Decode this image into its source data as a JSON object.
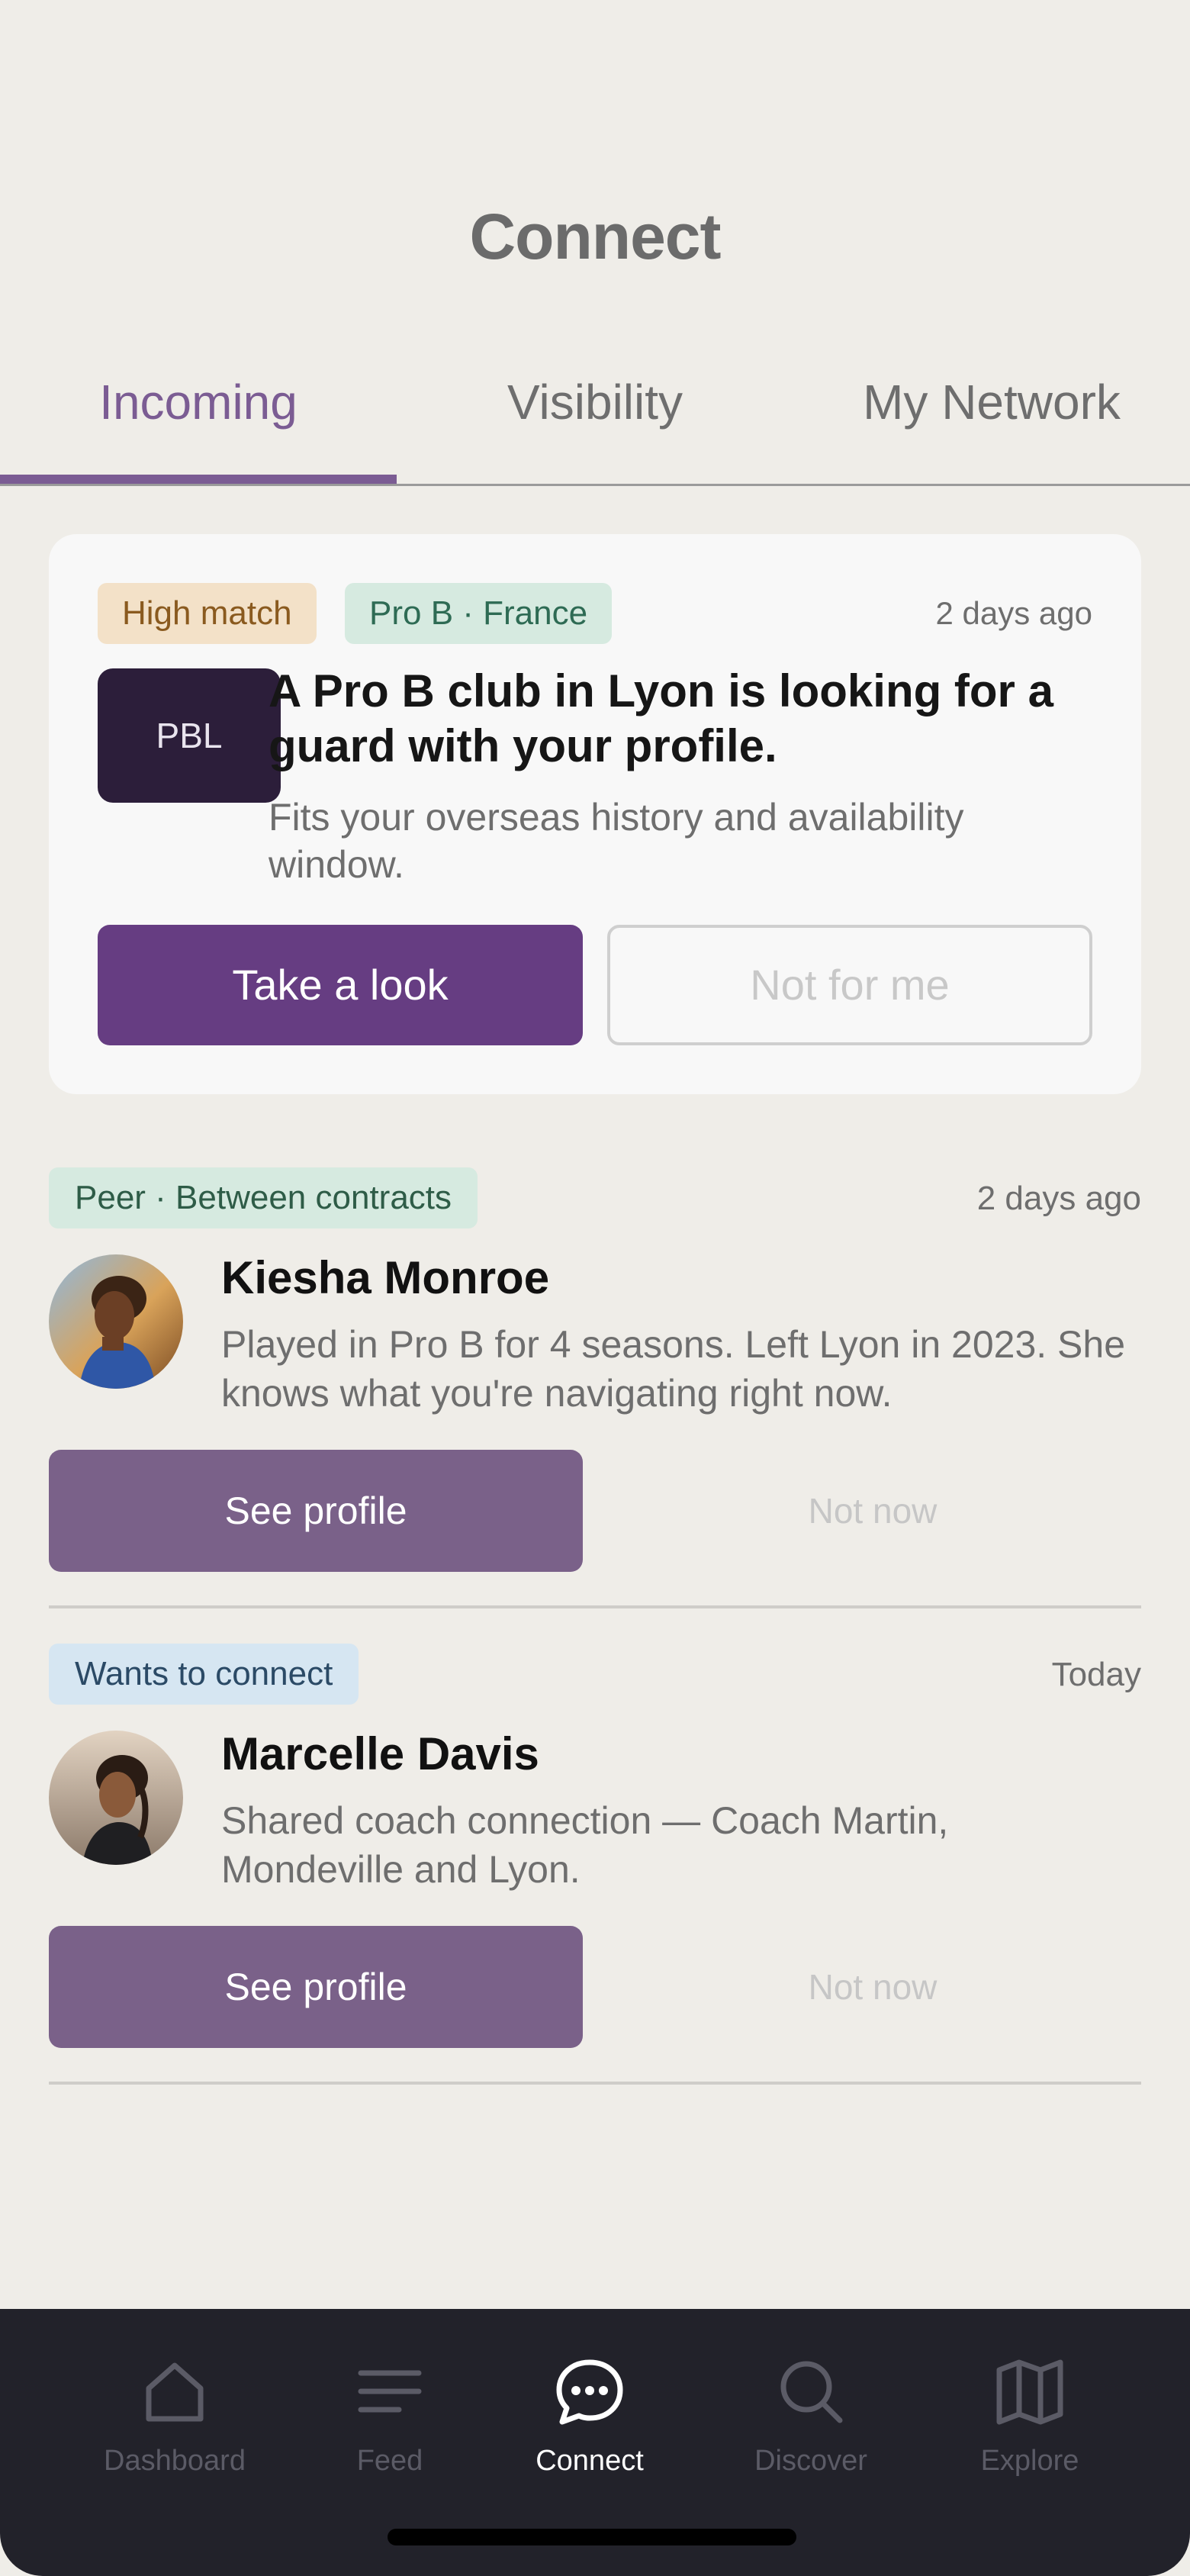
{
  "header": {
    "title": "Connect"
  },
  "tabs": [
    {
      "label": "Incoming",
      "active": true
    },
    {
      "label": "Visibility",
      "active": false
    },
    {
      "label": "My Network",
      "active": false
    }
  ],
  "featured": {
    "chip_match": "High match",
    "chip_league": "Pro B · France",
    "time": "2 days ago",
    "logo_text": "PBL",
    "headline": "A Pro B club in Lyon is looking for a guard with your profile.",
    "subtext": "Fits your overseas history and availability window.",
    "primary_label": "Take a look",
    "secondary_label": "Not for me"
  },
  "people": [
    {
      "chip": "Peer · Between contracts",
      "chip_style": "green",
      "time": "2 days ago",
      "name": "Kiesha Monroe",
      "description": "Played in Pro B for 4 seasons. Left Lyon in 2023. She knows what you're navigating right now.",
      "primary_label": "See profile",
      "secondary_label": "Not now"
    },
    {
      "chip": "Wants to connect",
      "chip_style": "blue",
      "time": "Today",
      "name": "Marcelle Davis",
      "description": "Shared coach connection — Coach Martin, Mondeville and Lyon.",
      "primary_label": "See profile",
      "secondary_label": "Not now"
    }
  ],
  "nav": [
    {
      "label": "Dashboard",
      "icon": "home-icon",
      "active": false
    },
    {
      "label": "Feed",
      "icon": "feed-icon",
      "active": false
    },
    {
      "label": "Connect",
      "icon": "chat-icon",
      "active": true
    },
    {
      "label": "Discover",
      "icon": "search-icon",
      "active": false
    },
    {
      "label": "Explore",
      "icon": "map-icon",
      "active": false
    }
  ],
  "colors": {
    "accent": "#7B5C93",
    "primary_button": "#663D82",
    "person_button": "#7A6189",
    "background": "#EFEDE8",
    "nav_background": "#22222A"
  }
}
